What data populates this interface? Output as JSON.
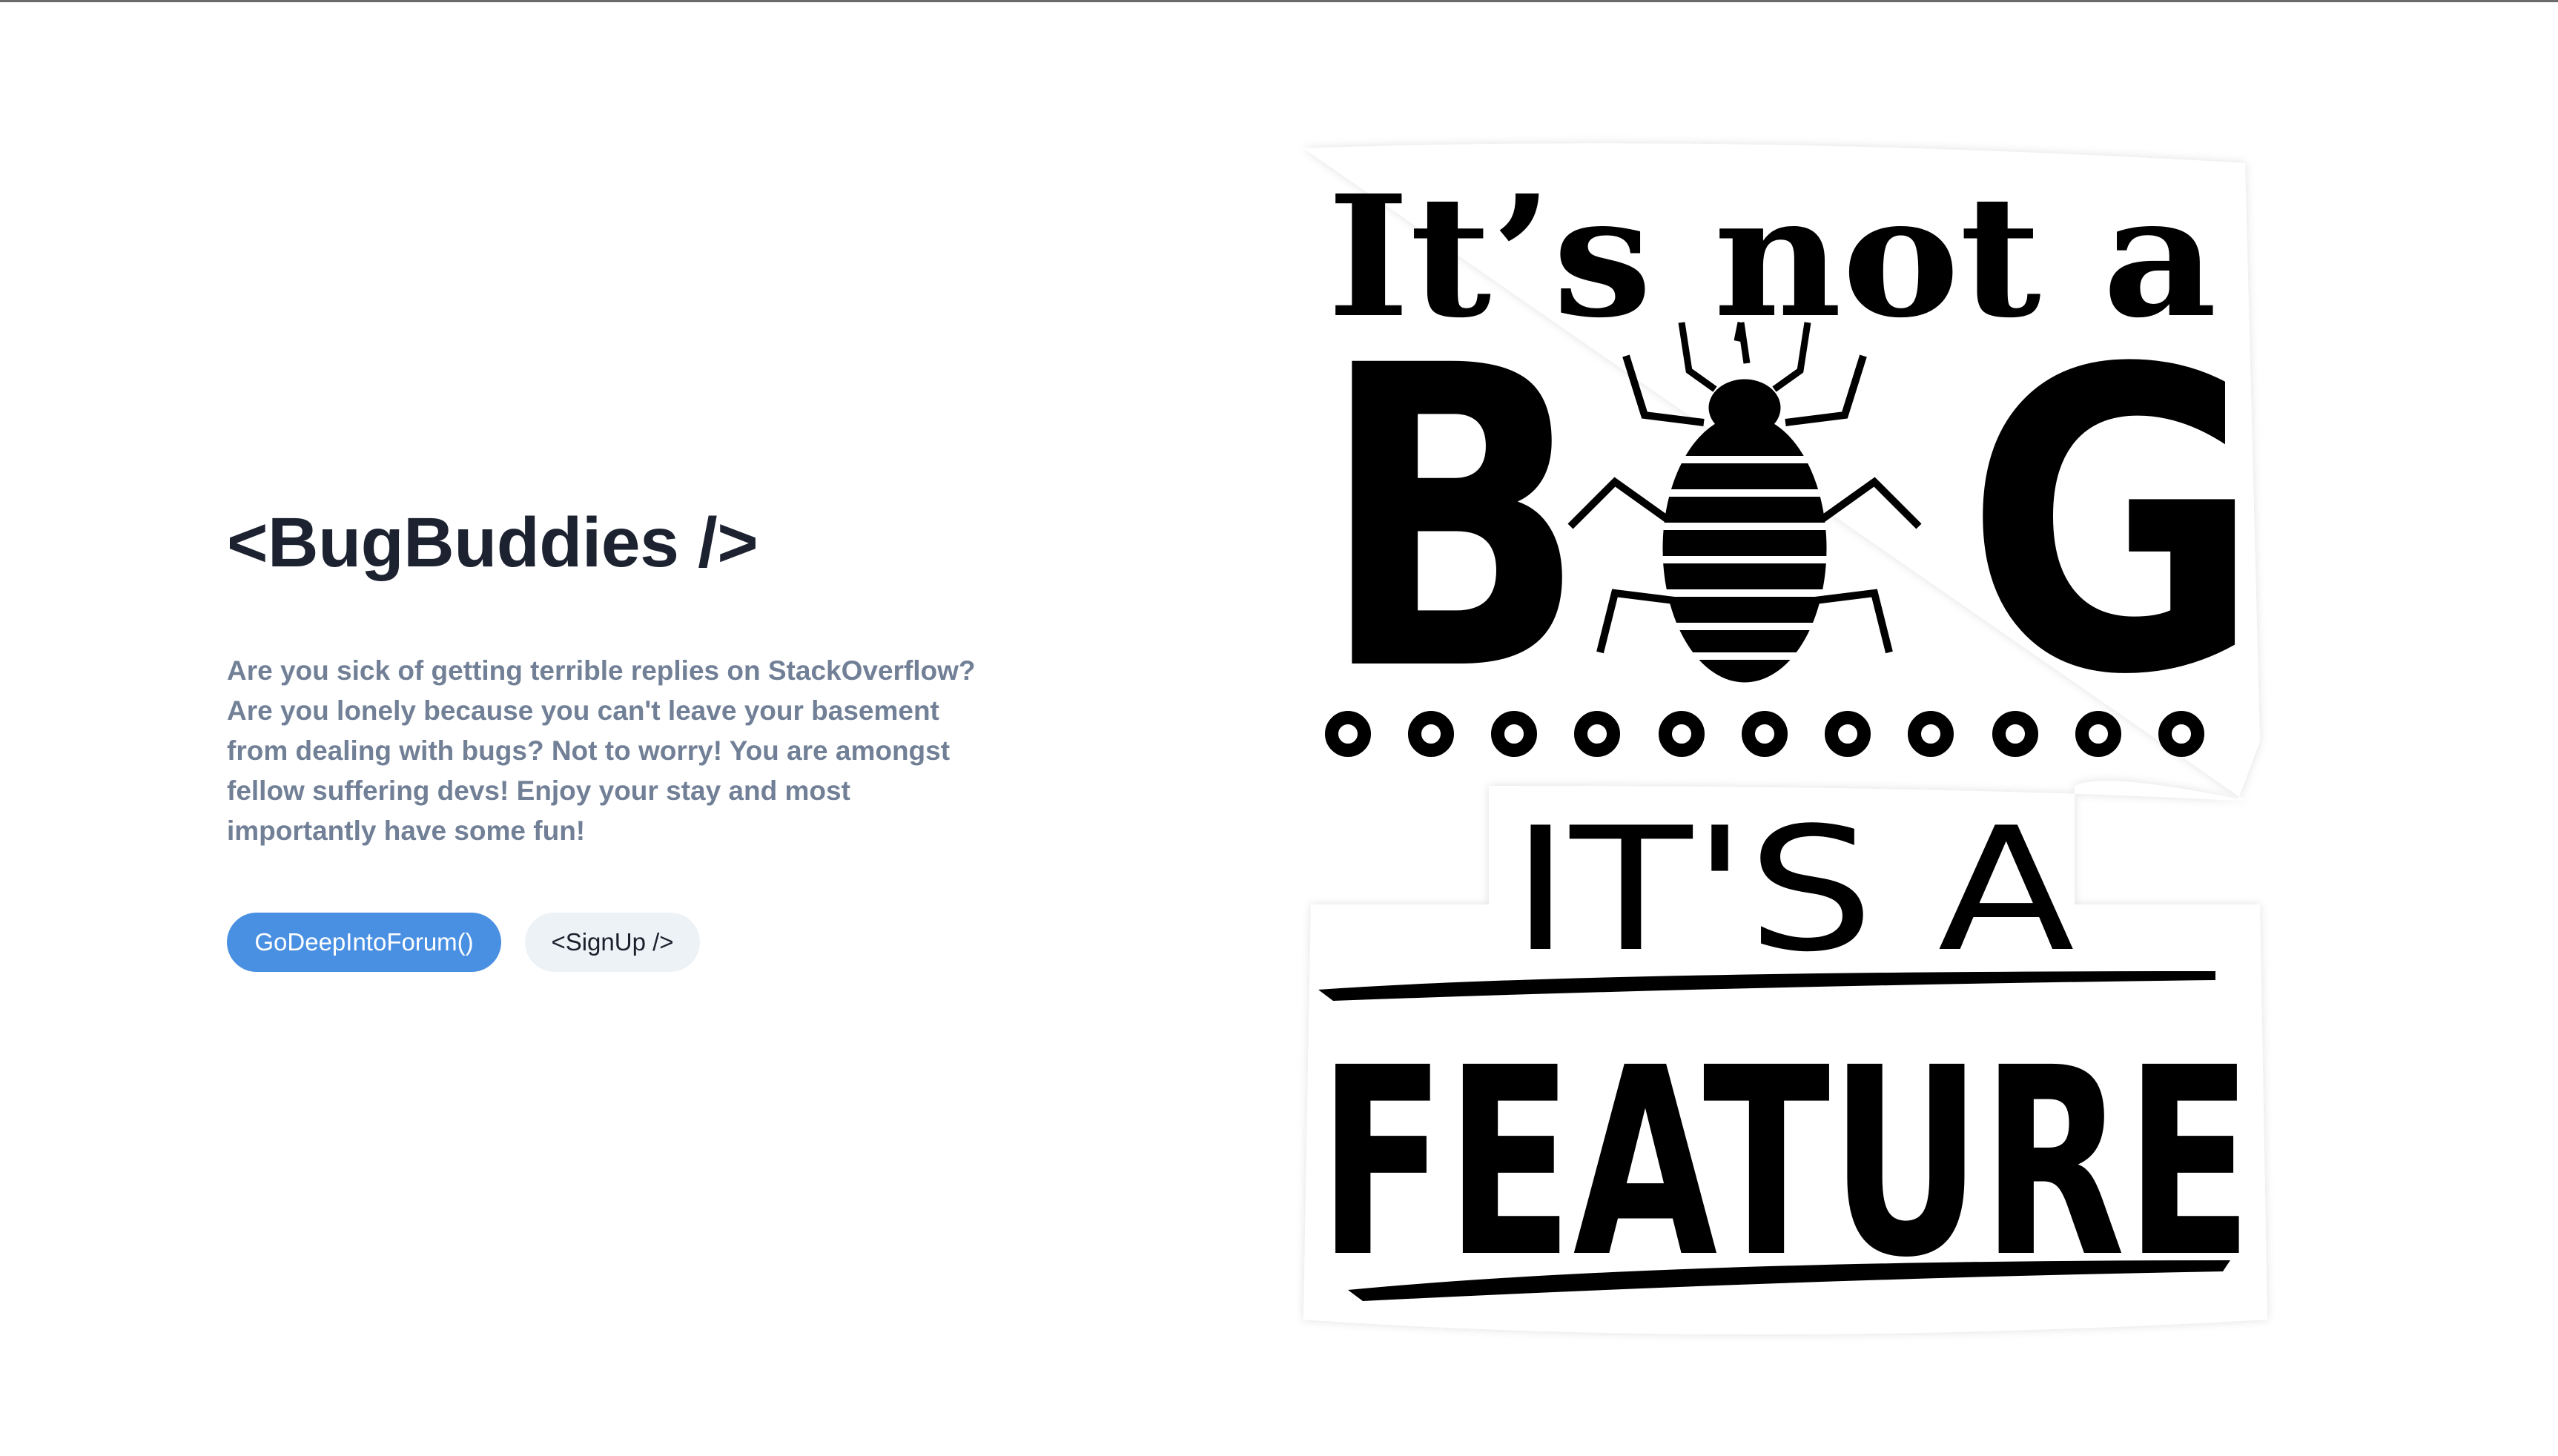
{
  "page": {
    "title": "<BugBuddies />",
    "tagline_lines": [
      "Are you sick of getting terrible replies on StackOverflow?",
      "Are you lonely because you can't leave your basement",
      "from dealing with bugs? Not to worry! You are amongst",
      "fellow suffering devs! Enjoy your stay and most",
      "importantly have some fun!"
    ]
  },
  "buttons": {
    "forum_label": "GoDeepIntoForum()",
    "signup_label": "<SignUp />"
  },
  "hero_image": {
    "line1": "It’s not a",
    "line2_left": "B",
    "line2_right": "G",
    "line3": "IT'S A",
    "line4": "FEATURE"
  },
  "colors": {
    "primary_button": "#4a90e2",
    "secondary_button": "#edf2f7",
    "title": "#1c2230",
    "tagline": "#718096"
  }
}
